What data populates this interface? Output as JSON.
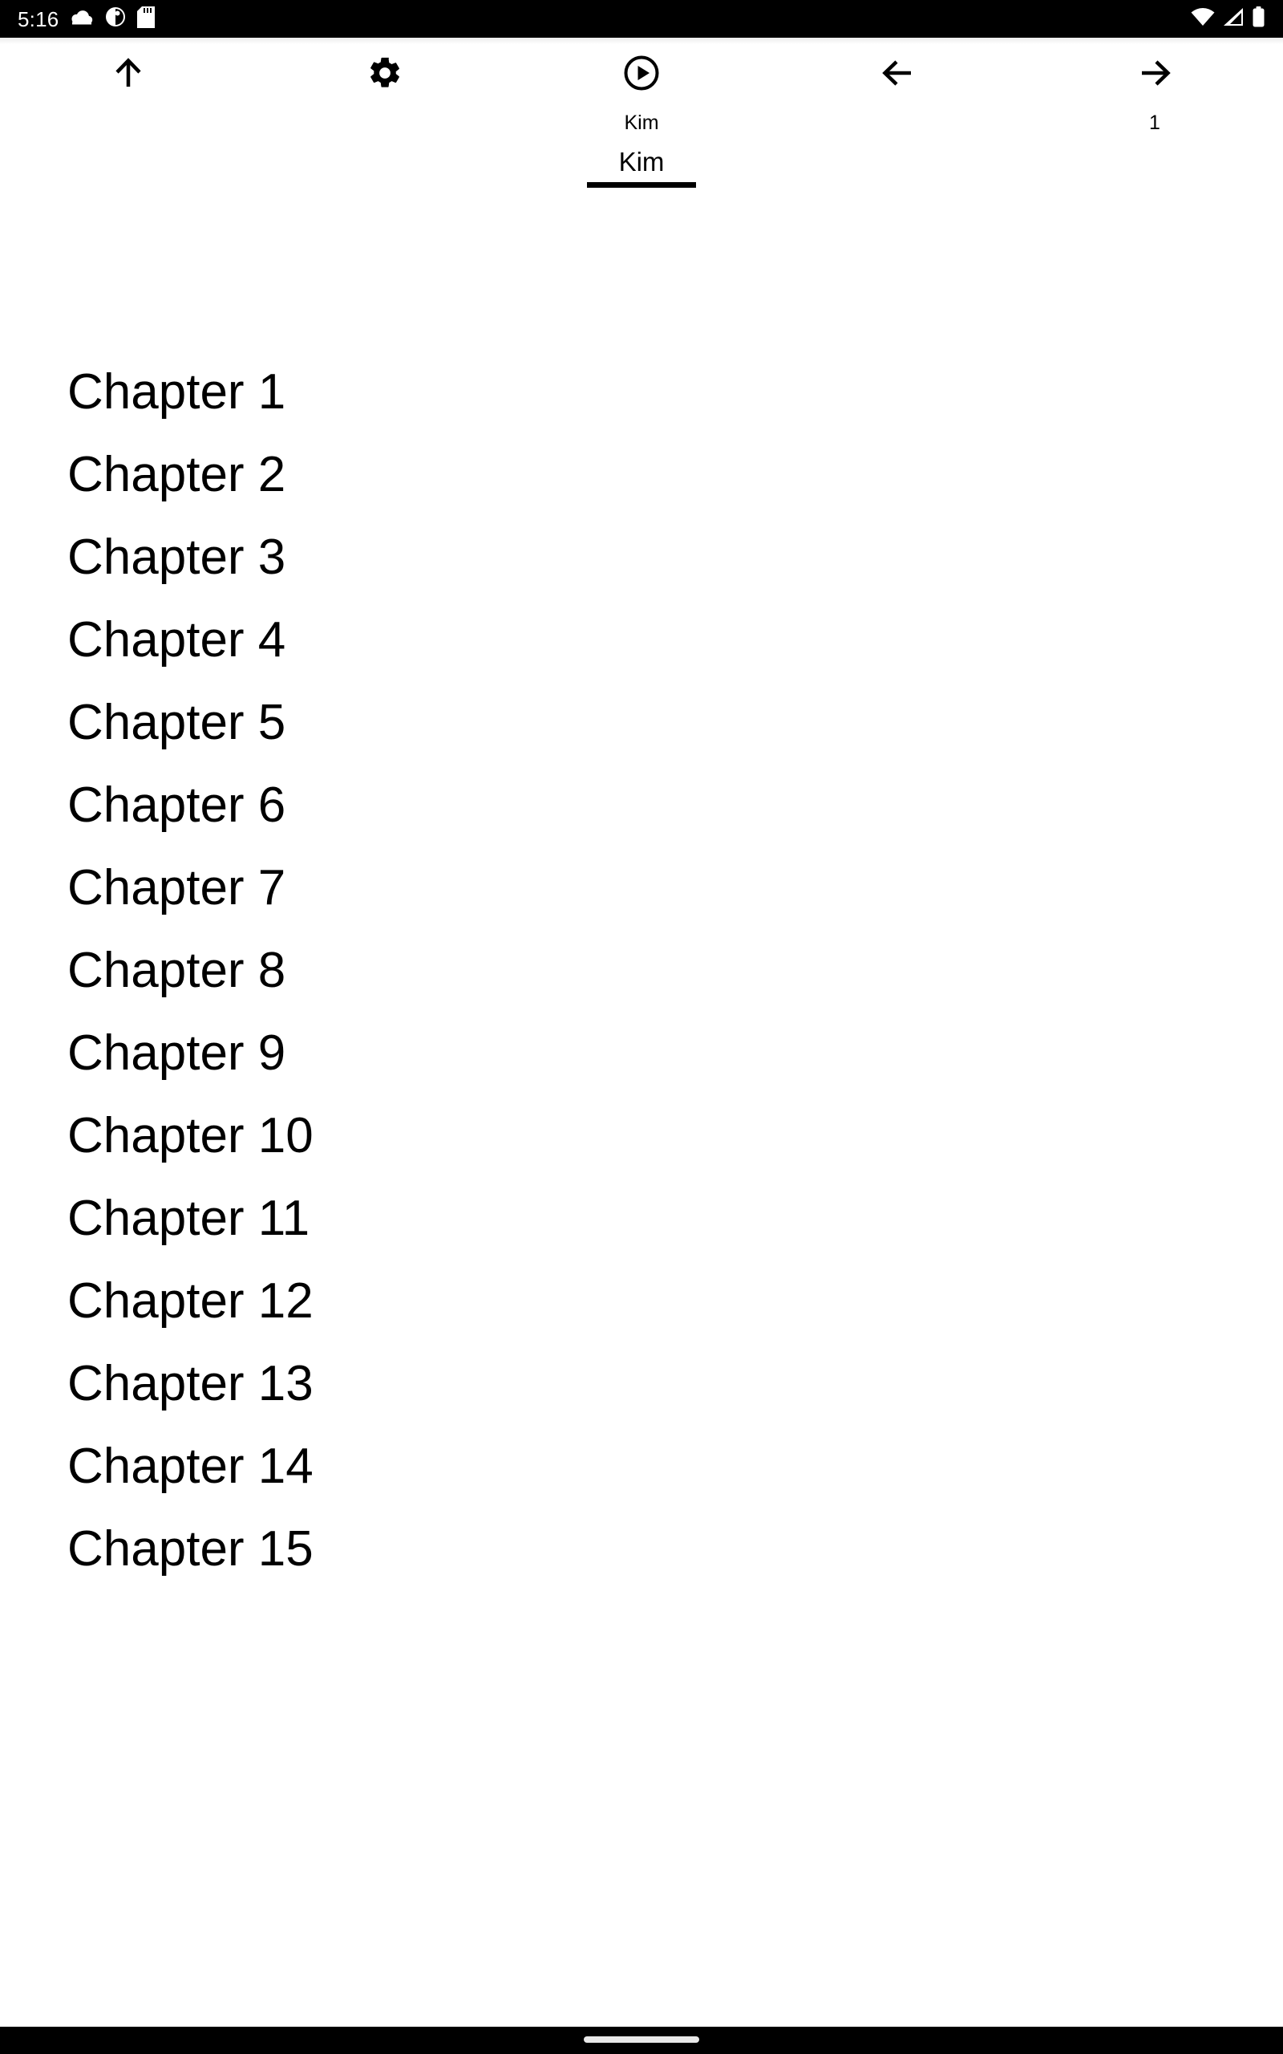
{
  "status_bar": {
    "time": "5:16",
    "left_icons": [
      "cloud-icon",
      "circle-half-icon",
      "sd-card-icon"
    ],
    "right_icons": [
      "wifi-icon",
      "cellular-signal-icon",
      "battery-icon"
    ],
    "background_color": "#000000",
    "foreground_color": "#ffffff"
  },
  "toolbar": {
    "items": [
      {
        "name": "scroll-to-top",
        "icon": "arrow-up-icon",
        "label": ""
      },
      {
        "name": "settings",
        "icon": "gear-icon",
        "label": ""
      },
      {
        "name": "play-source",
        "icon": "play-circle-icon",
        "label": "Kim"
      },
      {
        "name": "previous-page",
        "icon": "arrow-left-icon",
        "label": ""
      },
      {
        "name": "next-page",
        "icon": "arrow-right-icon",
        "label": "1"
      }
    ],
    "selected_tab": "Kim"
  },
  "main": {
    "chapters": [
      "Chapter 1",
      "Chapter 2",
      "Chapter 3",
      "Chapter 4",
      "Chapter 5",
      "Chapter 6",
      "Chapter 7",
      "Chapter 8",
      "Chapter 9",
      "Chapter 10",
      "Chapter 11",
      "Chapter 12",
      "Chapter 13",
      "Chapter 14",
      "Chapter 15"
    ]
  },
  "nav_bar": {
    "gesture_handle": "home-gesture-pill",
    "background_color": "#000000",
    "pill_color": "#e8e8e8"
  },
  "theme": {
    "page_background": "#ffffff",
    "text_color": "#000000"
  }
}
